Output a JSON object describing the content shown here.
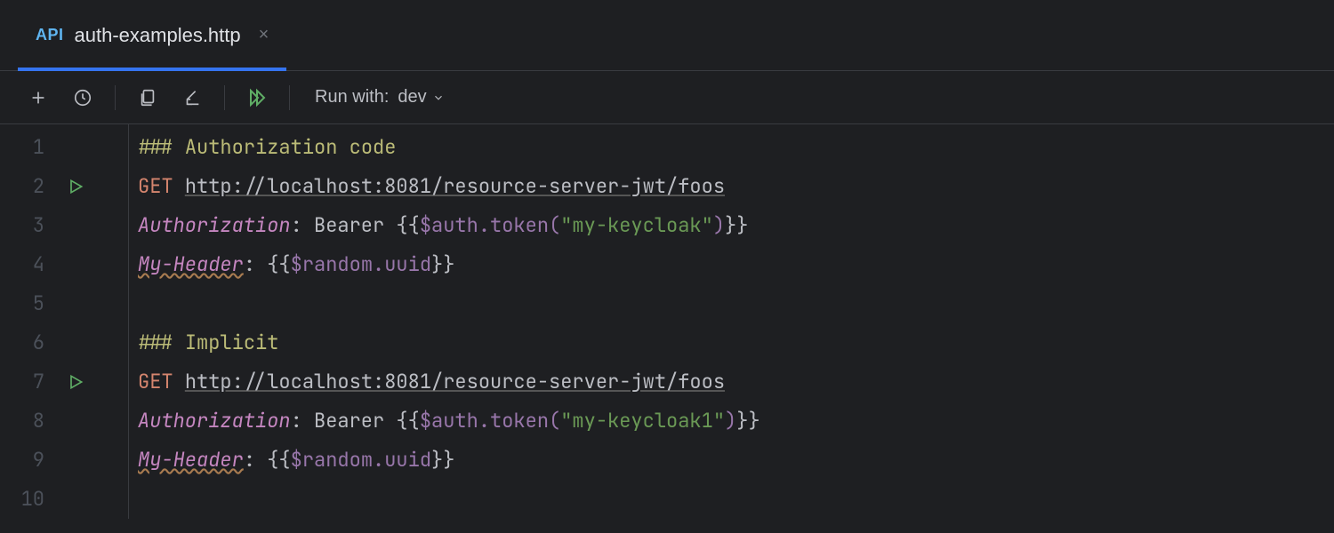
{
  "tab": {
    "icon_label": "API",
    "filename": "auth-examples.http"
  },
  "toolbar": {
    "run_with_label": "Run with:",
    "env": "dev"
  },
  "lines": [
    {
      "n": "1",
      "run": false,
      "tokens": [
        [
          "sep",
          "### "
        ],
        [
          "sep",
          "Authorization code"
        ]
      ]
    },
    {
      "n": "2",
      "run": true,
      "tokens": [
        [
          "method",
          "GET "
        ],
        [
          "url",
          "http://localhost:8081/resource-server-jwt/foos"
        ]
      ]
    },
    {
      "n": "3",
      "run": false,
      "tokens": [
        [
          "hkey",
          "Authorization"
        ],
        [
          "text",
          ": Bearer "
        ],
        [
          "brace",
          "{{"
        ],
        [
          "var",
          "$auth.token("
        ],
        [
          "str",
          "\"my-keycloak\""
        ],
        [
          "var",
          ")"
        ],
        [
          "brace",
          "}}"
        ]
      ]
    },
    {
      "n": "4",
      "run": false,
      "tokens": [
        [
          "hkeyw",
          "My-Header"
        ],
        [
          "text",
          ": "
        ],
        [
          "brace",
          "{{"
        ],
        [
          "var",
          "$random.uuid"
        ],
        [
          "brace",
          "}}"
        ]
      ]
    },
    {
      "n": "5",
      "run": false,
      "tokens": []
    },
    {
      "n": "6",
      "run": false,
      "tokens": [
        [
          "sep",
          "### "
        ],
        [
          "sep",
          "Implicit"
        ]
      ]
    },
    {
      "n": "7",
      "run": true,
      "tokens": [
        [
          "method",
          "GET "
        ],
        [
          "url",
          "http://localhost:8081/resource-server-jwt/foos"
        ]
      ]
    },
    {
      "n": "8",
      "run": false,
      "tokens": [
        [
          "hkey",
          "Authorization"
        ],
        [
          "text",
          ": Bearer "
        ],
        [
          "brace",
          "{{"
        ],
        [
          "var",
          "$auth.token("
        ],
        [
          "str",
          "\"my-keycloak1\""
        ],
        [
          "var",
          ")"
        ],
        [
          "brace",
          "}}"
        ]
      ]
    },
    {
      "n": "9",
      "run": false,
      "tokens": [
        [
          "hkeyw",
          "My-Header"
        ],
        [
          "text",
          ": "
        ],
        [
          "brace",
          "{{"
        ],
        [
          "var",
          "$random.uuid"
        ],
        [
          "brace",
          "}}"
        ]
      ]
    },
    {
      "n": "10",
      "run": false,
      "tokens": []
    }
  ]
}
